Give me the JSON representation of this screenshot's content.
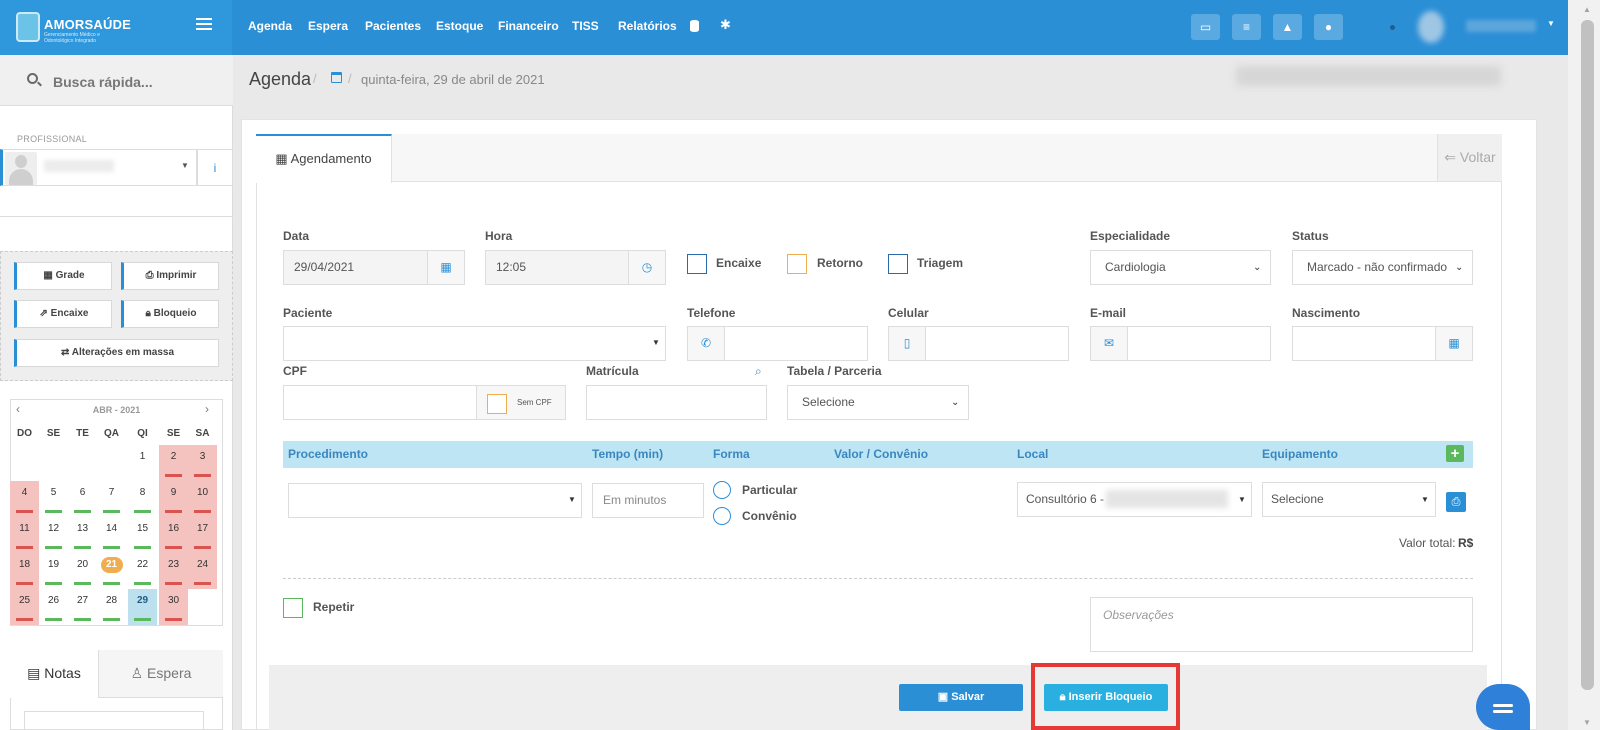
{
  "brand": {
    "name": "AMORSAÚDE",
    "tagline": "Gerenciamento Médico e Odontológico Integrado"
  },
  "nav": [
    "Agenda",
    "Espera",
    "Pacientes",
    "Estoque",
    "Financeiro",
    "TISS",
    "Relatórios"
  ],
  "sidebar": {
    "quick_search": "Busca rápida...",
    "profissional_label": "PROFISSIONAL",
    "buttons": {
      "grade": "Grade",
      "imprimir": "Imprimir",
      "encaixe": "Encaixe",
      "bloqueio": "Bloqueio",
      "massa": "Alterações em massa"
    },
    "calendar": {
      "title": "ABR - 2021",
      "weekdays": [
        "DO",
        "SE",
        "TE",
        "QA",
        "QI",
        "SE",
        "SA"
      ],
      "today": 21,
      "selected": 29
    },
    "tabs": {
      "notas": "Notas",
      "espera": "Espera"
    }
  },
  "breadcrumb": {
    "title": "Agenda",
    "date": "quinta-feira, 29 de abril de 2021"
  },
  "form": {
    "tab": "Agendamento",
    "voltar": "Voltar",
    "data_label": "Data",
    "data_value": "29/04/2021",
    "hora_label": "Hora",
    "hora_value": "12:05",
    "encaixe": "Encaixe",
    "retorno": "Retorno",
    "triagem": "Triagem",
    "especialidade_label": "Especialidade",
    "especialidade_value": "Cardiologia",
    "status_label": "Status",
    "status_value": "Marcado - não confirmado",
    "paciente_label": "Paciente",
    "telefone_label": "Telefone",
    "celular_label": "Celular",
    "email_label": "E-mail",
    "nascimento_label": "Nascimento",
    "cpf_label": "CPF",
    "sem_cpf": "Sem CPF",
    "matricula_label": "Matrícula",
    "tabela_label": "Tabela / Parceria",
    "tabela_value": "Selecione",
    "proc_headers": [
      "Procedimento",
      "Tempo (min)",
      "Forma",
      "Valor / Convênio",
      "Local",
      "Equipamento"
    ],
    "tempo_placeholder": "Em minutos",
    "particular": "Particular",
    "convenio": "Convênio",
    "local_value": "Consultório 6 -",
    "equip_value": "Selecione",
    "valor_total": "Valor total:",
    "moeda": "R$",
    "repetir": "Repetir",
    "obs_placeholder": "Observações",
    "salvar": "Salvar",
    "inserir_bloqueio": "Inserir Bloqueio"
  },
  "colors": {
    "primary": "#2b8fd6",
    "header_bg": "#2b8fd6",
    "weekend": "#f4c3c0",
    "today": "#f0ad4e",
    "highlight": "#e53935",
    "table_head": "#bee5f3"
  }
}
